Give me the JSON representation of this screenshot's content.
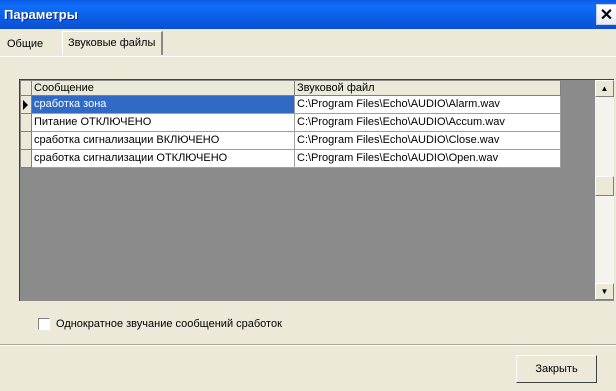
{
  "window": {
    "title": "Параметры",
    "close_glyph": "✕"
  },
  "tabs": [
    {
      "label": "Общие",
      "active": false
    },
    {
      "label": "Звуковые файлы",
      "active": true
    }
  ],
  "grid": {
    "columns": [
      "Сообщение",
      "Звуковой файл"
    ],
    "rows": [
      {
        "message": "сработка зона",
        "file": "C:\\Program Files\\Echo\\AUDIO\\Alarm.wav",
        "selected": true
      },
      {
        "message": "Питание ОТКЛЮЧЕНО",
        "file": "C:\\Program Files\\Echo\\AUDIO\\Accum.wav",
        "selected": false
      },
      {
        "message": "сработка сигнализации ВКЛЮЧЕНО",
        "file": "C:\\Program Files\\Echo\\AUDIO\\Close.wav",
        "selected": false
      },
      {
        "message": "сработка сигнализации ОТКЛЮЧЕНО",
        "file": "C:\\Program Files\\Echo\\AUDIO\\Open.wav",
        "selected": false
      }
    ]
  },
  "scroll": {
    "up_glyph": "▲",
    "down_glyph": "▼"
  },
  "option": {
    "label": "Однократное звучание сообщений сработок",
    "checked": false
  },
  "footer": {
    "close_label": "Закрыть"
  },
  "colors": {
    "titlebar": "#0a5be6",
    "selection": "#316ac5",
    "dialog": "#ece9d8",
    "grid_bg": "#8b8b8b"
  }
}
